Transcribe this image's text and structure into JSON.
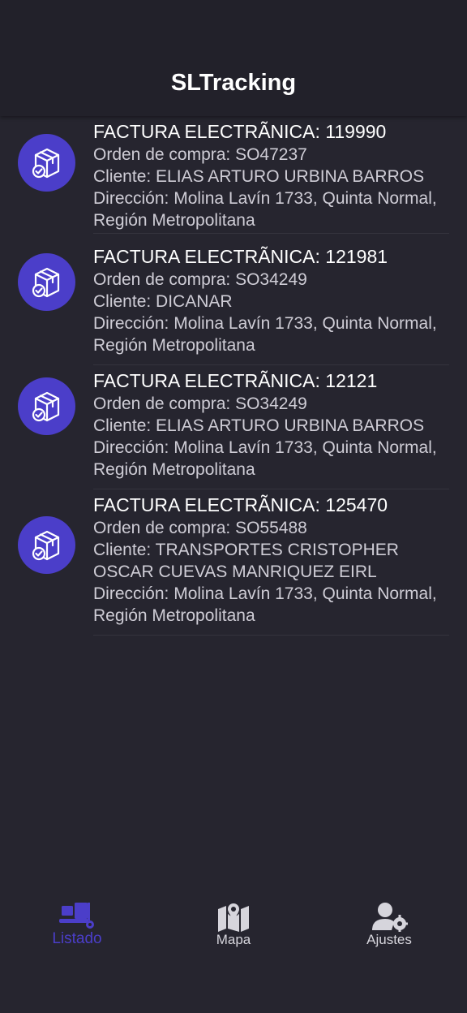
{
  "header": {
    "title": "SLTracking"
  },
  "items": [
    {
      "heading": "FACTURA ELECTRÃNICA: 119990",
      "order": "Orden de compra: SO47237",
      "client": "Cliente: ELIAS ARTURO URBINA BARROS",
      "address": "Dirección: Molina Lavín 1733, Quinta Normal, Región Metropolitana"
    },
    {
      "heading": "FACTURA ELECTRÃNICA: 121981",
      "order": "Orden de compra: SO34249",
      "client": "Cliente: DICANAR",
      "address": "Dirección: Molina Lavín 1733, Quinta Normal, Región Metropolitana"
    },
    {
      "heading": "FACTURA ELECTRÃNICA: 12121",
      "order": "Orden de compra: SO34249",
      "client": "Cliente: ELIAS ARTURO URBINA BARROS",
      "address": "Dirección: Molina Lavín 1733, Quinta Normal, Región Metropolitana"
    },
    {
      "heading": "FACTURA ELECTRÃNICA: 125470",
      "order": "Orden de compra: SO55488",
      "client": "Cliente: TRANSPORTES CRISTOPHER OSCAR CUEVAS MANRIQUEZ EIRL",
      "address": "Dirección: Molina Lavín 1733, Quinta Normal, Región Metropolitana"
    }
  ],
  "tabs": [
    {
      "label": "Listado",
      "icon": "dolly-icon",
      "active": true
    },
    {
      "label": "Mapa",
      "icon": "map-icon",
      "active": false
    },
    {
      "label": "Ajustes",
      "icon": "user-settings-icon",
      "active": false
    }
  ],
  "colors": {
    "accent": "#4b3ec9",
    "background": "#26252f",
    "header": "#22212a"
  }
}
